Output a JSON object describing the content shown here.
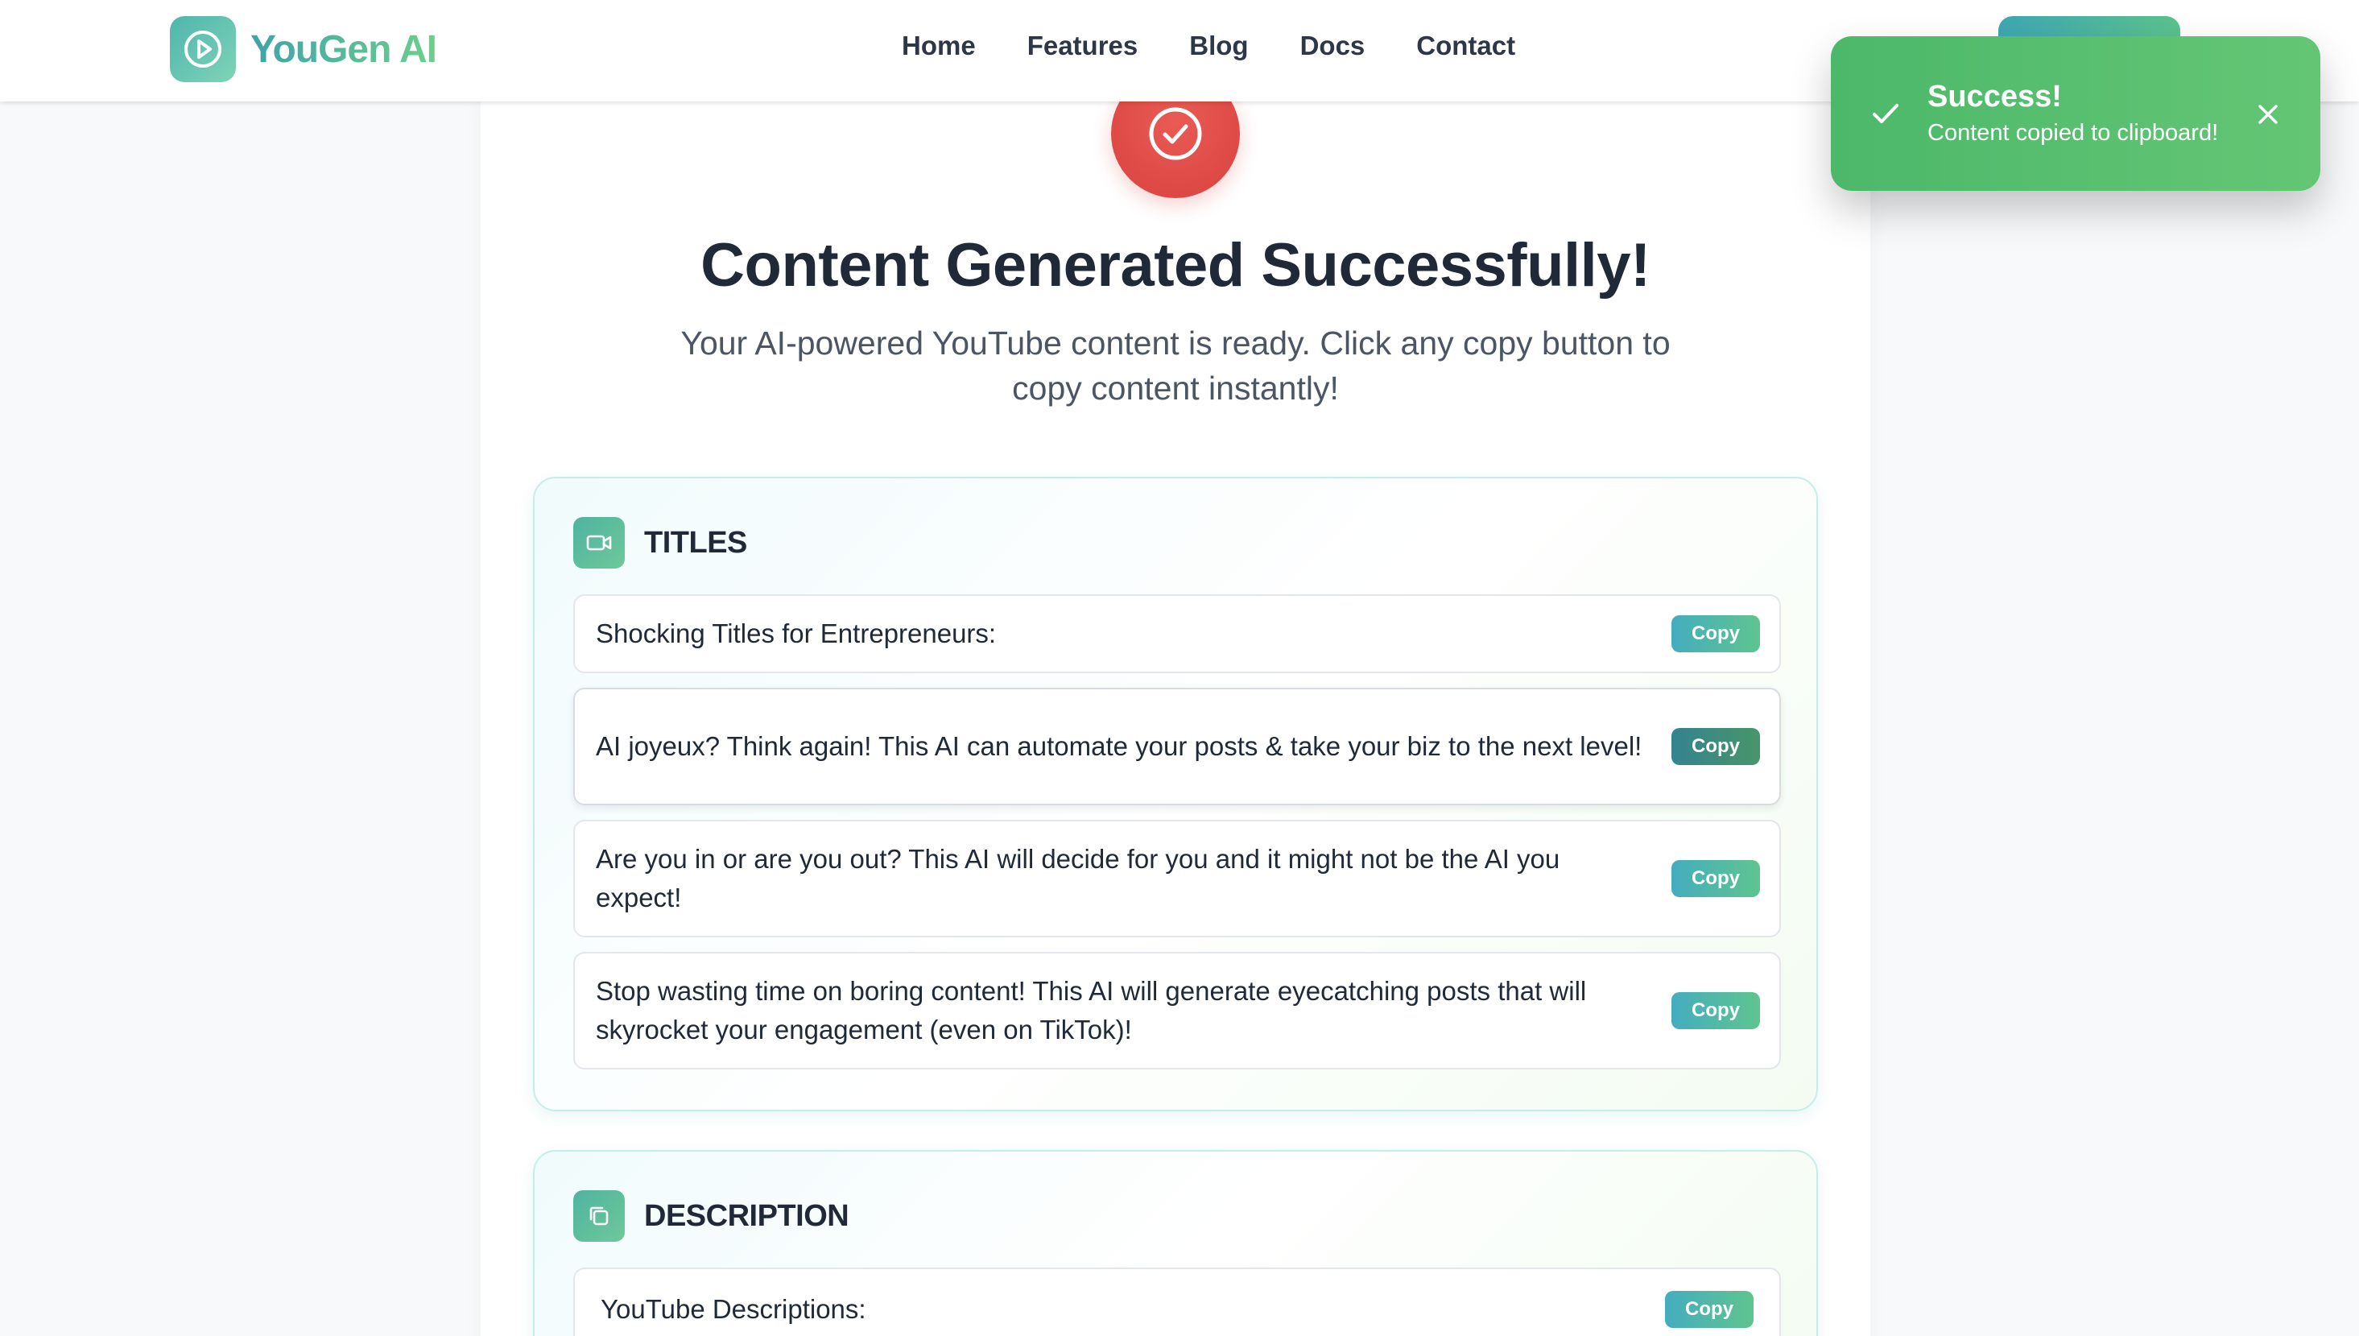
{
  "header": {
    "logo_text": "YouGen AI",
    "nav": [
      "Home",
      "Features",
      "Blog",
      "Docs",
      "Contact"
    ]
  },
  "hero": {
    "title": "Content Generated Successfully!",
    "subtitle": "Your AI-powered YouTube content is ready. Click any copy button to copy content instantly!"
  },
  "titles_section": {
    "heading": "TITLES",
    "copy_label": "Copy",
    "items": [
      "Shocking Titles for Entrepreneurs:",
      "AI joyeux? Think again! This AI can automate your posts & take your biz to the next level!",
      "Are you in or are you out? This AI will decide for you and it might not be the AI you expect!",
      "Stop wasting time on boring content! This AI will generate eyecatching posts that will skyrocket your engagement (even on TikTok)!"
    ]
  },
  "description_section": {
    "heading": "DESCRIPTION",
    "copy_label": "Copy",
    "items": [
      "YouTube Descriptions:"
    ]
  },
  "toast": {
    "title": "Success!",
    "message": "Content copied to clipboard!"
  },
  "colors": {
    "accent_teal": "#44adbf",
    "accent_green": "#5fc48f",
    "success_toast": "#4cb86a",
    "hero_red": "#d8433f"
  }
}
